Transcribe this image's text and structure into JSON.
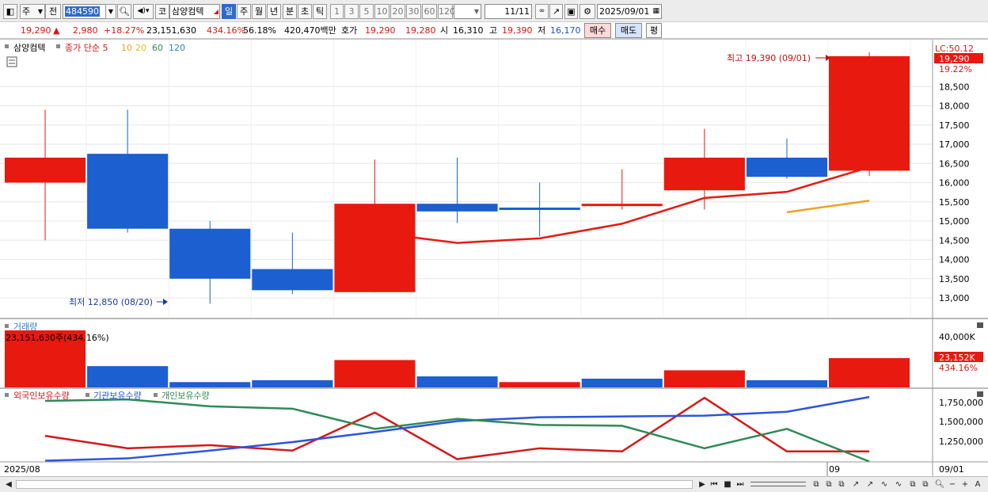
{
  "toolbar": {
    "market": "주",
    "lookup_label": "전",
    "code": "484590",
    "product_type": "코",
    "stock_name": "삼양컴텍",
    "periods": [
      "일",
      "주",
      "월",
      "년",
      "분",
      "초",
      "틱"
    ],
    "selected_period": "일",
    "intervals": [
      "1",
      "3",
      "5",
      "10",
      "20",
      "30",
      "60",
      "120"
    ],
    "count": "11",
    "count_total": "/11",
    "date": "2025/09/01"
  },
  "quote": {
    "price": "19,290",
    "change": "2,980",
    "change_pct": "+18.27%",
    "volume": "23,151,630",
    "volume_ratio": "434.16%",
    "turnover_pct": "56.18%",
    "amount": "420,470백만",
    "ask_label": "호가",
    "ask": "19,290",
    "bid": "19,280",
    "open_label": "시",
    "open": "16,310",
    "high_label": "고",
    "high": "19,390",
    "low_label": "저",
    "low": "16,170",
    "buy_label": "매수",
    "sell_label": "매도",
    "eval_label": "평"
  },
  "price_pane": {
    "legend_name": "삼양컴텍",
    "legend_series": "종가 단순 5",
    "ma_periods": [
      "10",
      "20",
      "60",
      "120"
    ],
    "lc": "LC:50.12",
    "last_price_tag": "19,290",
    "last_pct": "19.22%",
    "high_note": "최고 19,390 (09/01)",
    "low_note": "최저 12,850 (08/20)",
    "y_ticks": [
      "18,500",
      "18,000",
      "17,500",
      "17,000",
      "16,500",
      "16,000",
      "15,500",
      "15,000",
      "14,500",
      "14,000",
      "13,500",
      "13,000"
    ]
  },
  "volume_pane": {
    "label": "거래량",
    "value_note": "23,151,630주(434.16%)",
    "y_tick": "40,000K",
    "last_tag": "23,152K",
    "last_pct": "434.16%"
  },
  "holding_pane": {
    "labels": [
      "외국인보유수량",
      "기관보유수량",
      "개인보유수량"
    ],
    "y_ticks": [
      "1,750,000",
      "1,500,000",
      "1,250,000"
    ]
  },
  "x_axis": {
    "left_label": "2025/08",
    "month_marker": "09",
    "right_label": "09/01"
  },
  "colors": {
    "up": "#e8190f",
    "down": "#1b5fd1",
    "ma5": "#e8190f",
    "ma10": "#f0a020",
    "foreign": "#d41818",
    "institution": "#2b55e0",
    "individual": "#2e8a57"
  },
  "chart_data": {
    "type": "candlestick",
    "candles": [
      {
        "open": 16000,
        "high": 17900,
        "low": 14500,
        "close": 16650
      },
      {
        "open": 16750,
        "high": 17900,
        "low": 14700,
        "close": 14800
      },
      {
        "open": 14800,
        "high": 15000,
        "low": 12850,
        "close": 13500
      },
      {
        "open": 13750,
        "high": 14700,
        "low": 13100,
        "close": 13200
      },
      {
        "open": 13150,
        "high": 16600,
        "low": 13150,
        "close": 15450
      },
      {
        "open": 15450,
        "high": 16650,
        "low": 14950,
        "close": 15250
      },
      {
        "open": 15350,
        "high": 16000,
        "low": 14600,
        "close": 15300
      },
      {
        "open": 15400,
        "high": 16350,
        "low": 15300,
        "close": 15450
      },
      {
        "open": 15800,
        "high": 17400,
        "low": 15300,
        "close": 16650
      },
      {
        "open": 16650,
        "high": 17150,
        "low": 16100,
        "close": 16150
      },
      {
        "open": 16310,
        "high": 19390,
        "low": 16170,
        "close": 19290
      }
    ],
    "ma5": [
      null,
      null,
      null,
      null,
      14700,
      14430,
      14550,
      14930,
      15600,
      15760,
      16400
    ],
    "ma10": [
      null,
      null,
      null,
      null,
      null,
      null,
      null,
      null,
      null,
      15230,
      15530
    ],
    "volume": [
      15000,
      5600,
      1400,
      1900,
      7200,
      2900,
      1400,
      2300,
      4500,
      1900,
      7700
    ],
    "volume_up": [
      true,
      false,
      false,
      false,
      true,
      false,
      true,
      false,
      true,
      false,
      true
    ],
    "foreign": [
      1320000,
      1160000,
      1200000,
      1130000,
      1620000,
      1020000,
      1160000,
      1120000,
      1810000,
      1120000,
      1120000
    ],
    "institution": [
      1000000,
      1030000,
      1130000,
      1240000,
      1370000,
      1510000,
      1560000,
      1570000,
      1580000,
      1630000,
      1820000
    ],
    "individual": [
      1770000,
      1790000,
      1700000,
      1670000,
      1410000,
      1540000,
      1460000,
      1450000,
      1160000,
      1410000,
      990000
    ]
  }
}
